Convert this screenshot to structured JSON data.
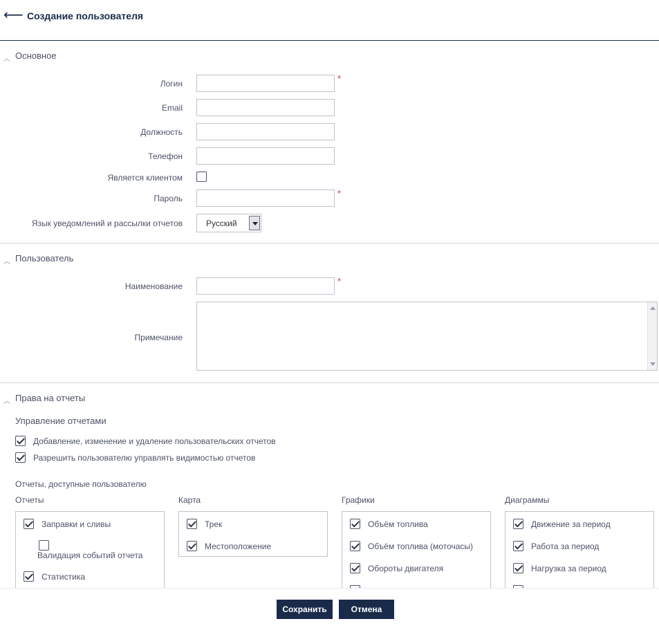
{
  "header": {
    "title": "Создание пользователя"
  },
  "sections": {
    "basic": {
      "title": "Основное"
    },
    "user": {
      "title": "Пользователь"
    },
    "reports": {
      "title": "Права на отчеты"
    }
  },
  "basic_form": {
    "login_label": "Логин",
    "email_label": "Email",
    "position_label": "Должность",
    "phone_label": "Телефон",
    "is_client_label": "Является клиентом",
    "password_label": "Пароль",
    "language_label": "Язык уведомлений и рассылки отчетов",
    "language_value": "Русский",
    "required_mark": "*"
  },
  "user_form": {
    "name_label": "Наименование",
    "note_label": "Примечание"
  },
  "reports": {
    "management_title": "Управление отчетами",
    "perm_edit": "Добавление, изменение и удаление пользовательских отчетов",
    "perm_visibility": "Разрешить пользователю управлять видимостью отчетов",
    "available_title": "Отчеты, доступные пользователю",
    "columns": {
      "reports": {
        "title": "Отчеты",
        "items": [
          "Заправки и сливы",
          "Валидация событий отчета",
          "Статистика"
        ]
      },
      "map": {
        "title": "Карта",
        "items": [
          "Трек",
          "Местоположение"
        ]
      },
      "graphs": {
        "title": "Графики",
        "items": [
          "Объём топлива",
          "Объём топлива (моточасы)",
          "Обороты двигателя"
        ]
      },
      "diagrams": {
        "title": "Диаграммы",
        "items": [
          "Движение за период",
          "Работа за период",
          "Нагрузка за период"
        ]
      }
    }
  },
  "footer": {
    "save_label": "Сохранить",
    "cancel_label": "Отмена"
  },
  "colors": {
    "primary": "#1a2b4a",
    "required": "#d0353a",
    "text": "#4d5268"
  }
}
